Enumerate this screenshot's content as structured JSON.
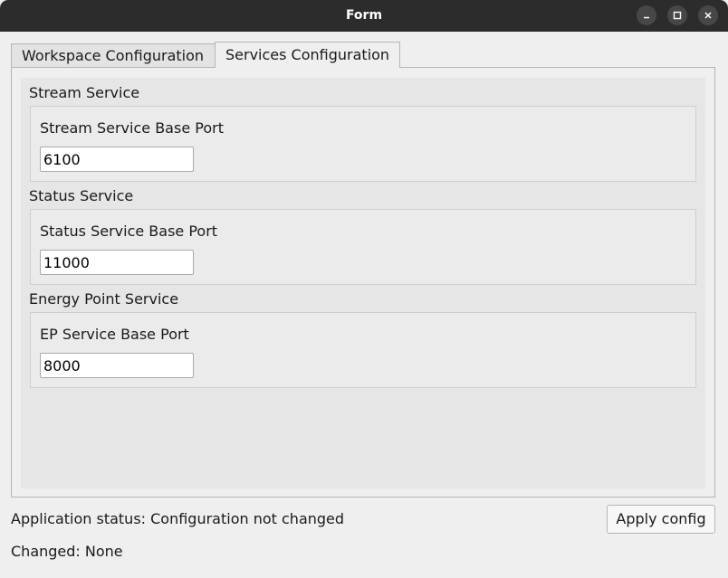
{
  "window": {
    "title": "Form"
  },
  "tabs": [
    {
      "label": "Workspace Configuration",
      "selected": false
    },
    {
      "label": "Services Configuration",
      "selected": true
    }
  ],
  "groups": [
    {
      "title": "Stream Service",
      "field_label": "Stream Service Base Port",
      "value": "6100"
    },
    {
      "title": "Status Service",
      "field_label": "Status Service Base Port",
      "value": "11000"
    },
    {
      "title": "Energy Point Service",
      "field_label": "EP Service Base Port",
      "value": "8000"
    }
  ],
  "footer": {
    "app_status": "Application status: Configuration not changed",
    "changed": "Changed: None",
    "apply_label": "Apply config"
  },
  "icons": {
    "minimize": "minimize-icon",
    "maximize": "maximize-icon",
    "close": "close-icon"
  }
}
